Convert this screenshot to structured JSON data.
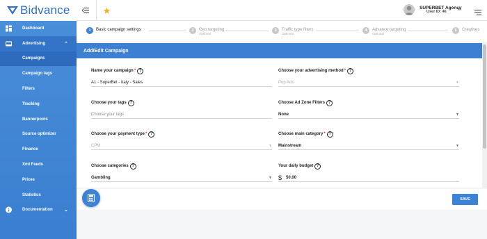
{
  "brand": {
    "name": "Bidvance"
  },
  "sidebar": {
    "items": [
      {
        "label": "Dashboard",
        "icon": "dashboard-icon"
      },
      {
        "label": "Advertising",
        "icon": "advertising-icon",
        "expanded": true
      },
      {
        "label": "Campaigns"
      },
      {
        "label": "Campaign tags"
      },
      {
        "label": "Filters"
      },
      {
        "label": "Tracking"
      },
      {
        "label": "Bannerpools"
      },
      {
        "label": "Source optimizer"
      },
      {
        "label": "Finance"
      },
      {
        "label": "Xml Feeds"
      },
      {
        "label": "Prices"
      },
      {
        "label": "Statistics"
      },
      {
        "label": "Documentation",
        "icon": "info-icon"
      }
    ]
  },
  "user": {
    "name": "SUPERBET Agency",
    "id_label": "User ID: 46"
  },
  "steps": [
    {
      "num": "1",
      "label": "Basic campaign settings",
      "sub": "",
      "active": true
    },
    {
      "num": "2",
      "label": "Geo targeting",
      "sub": "Optional"
    },
    {
      "num": "3",
      "label": "Traffic type filters",
      "sub": "Optional"
    },
    {
      "num": "4",
      "label": "Advance targeting",
      "sub": "Optional"
    },
    {
      "num": "5",
      "label": "Creatives",
      "sub": ""
    }
  ],
  "panel": {
    "title": "Add/Edit Campaign"
  },
  "form": {
    "campaign_name": {
      "label": "Name your campaign",
      "value": "A1 - SuperBet - Italy - Sales"
    },
    "advertising_method": {
      "label": "Choose your advertising method",
      "value": "Pop Ads"
    },
    "tags": {
      "label": "Choose your tags",
      "placeholder": "Choose your tags"
    },
    "ad_zone_filters": {
      "label": "Choose Ad Zone Filters",
      "value": "None"
    },
    "payment_type": {
      "label": "Choose your payment type",
      "value": "CPM"
    },
    "main_category": {
      "label": "Choose main category",
      "value": "Mainstream"
    },
    "categories": {
      "label": "Choose categories",
      "value": "Gambling"
    },
    "daily_budget": {
      "label": "Your daily budget",
      "currency": "$",
      "value": "50.00"
    }
  },
  "actions": {
    "save_label": "SAVE"
  },
  "colors": {
    "primary": "#3c82d6",
    "sidebar": "#4a8fd9",
    "star": "#f2b21c",
    "required": "#d33333"
  }
}
